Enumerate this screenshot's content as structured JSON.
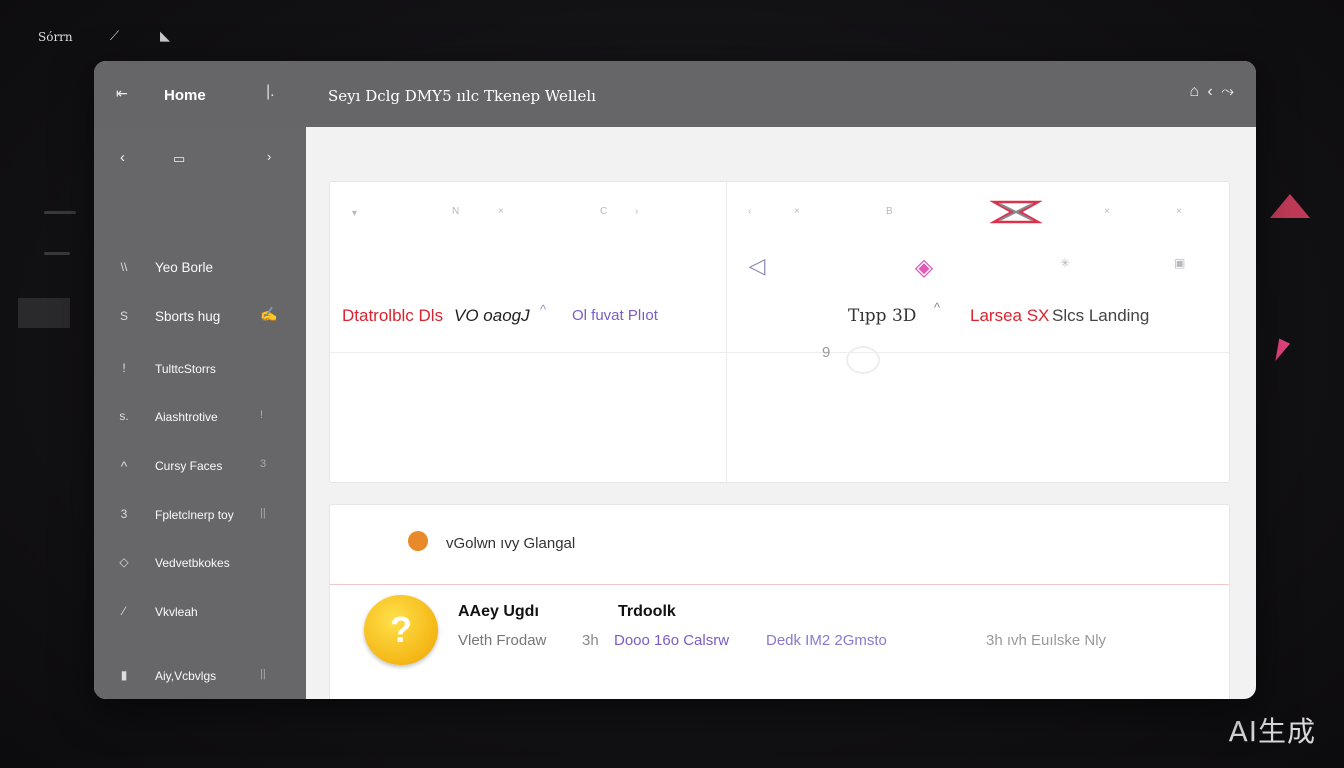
{
  "desktop": {
    "label": "Sόrrn",
    "icons": [
      "wrench-icon",
      "pin-icon"
    ],
    "watermark": "AI生成"
  },
  "titlebar": {
    "back_glyph": "⇤",
    "home_label": "Home",
    "pipe": "|.",
    "title": "Seyı Dclg DMY5 ıılc Tkenep Wellelı",
    "controls": "⌂ ‹ ⤳"
  },
  "sidebar": {
    "nav_prev": "‹",
    "nav_mid": "▭",
    "nav_next": "›",
    "items": [
      {
        "icon": "\\\\",
        "label": "Yeo Borle",
        "trail": ""
      },
      {
        "icon": "S",
        "label": "Sborts hug",
        "trail": "✍"
      },
      {
        "icon": "!",
        "label": "TulttcStorrs",
        "trail": ""
      },
      {
        "icon": "s.",
        "label": "Aiashtrotive",
        "trail": "!"
      },
      {
        "icon": "^",
        "label": "Cursy  Faces",
        "trail": "3"
      },
      {
        "icon": "3",
        "label": "Fpletclnerp toy",
        "trail": "||"
      },
      {
        "icon": "◇",
        "label": "Vedvetbkokes",
        "trail": ""
      },
      {
        "icon": "⁄",
        "label": "Vkvleah",
        "trail": ""
      },
      {
        "icon": "▮",
        "label": "Aiy,Vcbvlgs",
        "trail": "||"
      }
    ]
  },
  "apps_panel": {
    "left_tinies": [
      "▾",
      "N",
      "×",
      "C",
      "›"
    ],
    "right_tinies": [
      "‹",
      "×",
      "B",
      "×",
      "×"
    ],
    "left_icons": [
      {
        "name": "camera-app-icon",
        "color": "#e02a2a",
        "glyph": "◉"
      },
      {
        "name": "arrow-app-icon",
        "color": "#2cc3e0",
        "glyph": "⬈"
      },
      {
        "name": "monkey-app-icon",
        "color": "#5a2d1a",
        "glyph": "◕"
      },
      {
        "name": "globe-app-icon",
        "color": "#2a3fc8",
        "glyph": "◍"
      },
      {
        "name": "music-app-icon",
        "color": "#f0752a",
        "glyph": "♪"
      }
    ],
    "right_icons": [
      {
        "name": "play-outline-icon",
        "color": "#ffffff",
        "glyph": "◁"
      },
      {
        "name": "burger-app-icon",
        "color": "#ff9a1a",
        "glyph": "▣"
      },
      {
        "name": "lens-app-icon",
        "color": "#1c1c1c",
        "glyph": "◎"
      },
      {
        "name": "gem-app-icon",
        "color": "#ffffff",
        "glyph": "◈"
      },
      {
        "name": "cheese-app-icon",
        "color": "#f6b20c",
        "glyph": "▤"
      },
      {
        "name": "map-app-icon",
        "color": "#3f8ee6",
        "glyph": "▦"
      },
      {
        "name": "castle-app-icon",
        "color": "#3d3bd0",
        "glyph": "♜"
      }
    ],
    "caption_red": "Dtatrolblc Dls",
    "caption_dark": "VO oaogJ",
    "caption_caret": "^",
    "caption_purple": "Ol fuvat Plıot",
    "caption_tipp": "Tıpp 3D",
    "caption_caret2": "^",
    "caption_red2": "Larsea SX",
    "caption_landing": "Slcs Landing",
    "misc_number": "9"
  },
  "details_panel": {
    "status_text": "vGolwn ıvy Glangal",
    "badge_glyph": "?",
    "col1_title": "AAey Ugdı",
    "col2_title": "Trdoolk",
    "col1_detail": "Vleth Frodaw",
    "col2_prefix": "3h",
    "col2_detail": "Dooo 16o Calsrw",
    "col3_detail": "Dedk IM2 2Gmsto",
    "col4_detail": "3h  ıvh Euılske Nly"
  },
  "colors": {
    "titlebar": "#666568",
    "sidebar": "#676669",
    "accent_red": "#d9242e",
    "accent_purple": "#7a5cc4",
    "accent_orange": "#e8892a"
  }
}
